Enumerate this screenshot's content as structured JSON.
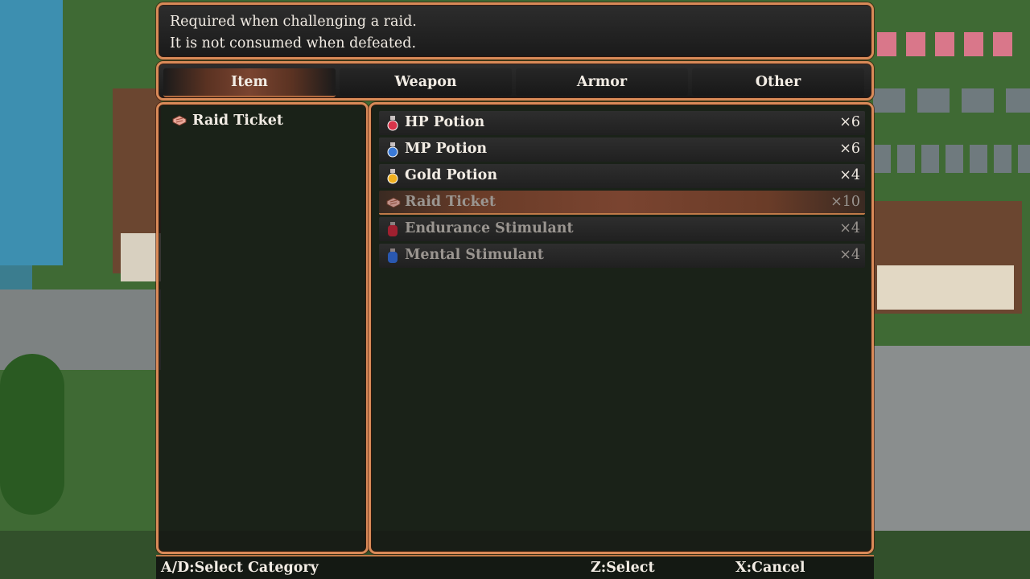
{
  "help": {
    "line1": "Required when challenging a raid.",
    "line2": "It is not consumed when defeated."
  },
  "categories": [
    {
      "label": "Item",
      "active": true
    },
    {
      "label": "Weapon",
      "active": false
    },
    {
      "label": "Armor",
      "active": false
    },
    {
      "label": "Other",
      "active": false
    }
  ],
  "detail": {
    "icon": "ticket-icon",
    "name": "Raid Ticket"
  },
  "items": [
    {
      "icon": "red-potion-icon",
      "name": "HP Potion",
      "qty": "×6",
      "state": "normal"
    },
    {
      "icon": "blue-potion-icon",
      "name": "MP Potion",
      "qty": "×6",
      "state": "normal"
    },
    {
      "icon": "gold-potion-icon",
      "name": "Gold Potion",
      "qty": "×4",
      "state": "normal"
    },
    {
      "icon": "ticket-icon",
      "name": "Raid Ticket",
      "qty": "×10",
      "state": "selected-disabled"
    },
    {
      "icon": "red-flask-icon",
      "name": "Endurance Stimulant",
      "qty": "×4",
      "state": "disabled"
    },
    {
      "icon": "blue-flask-icon",
      "name": "Mental Stimulant",
      "qty": "×4",
      "state": "disabled"
    }
  ],
  "footer": {
    "select_category": "A/D:Select Category",
    "select": "Z:Select",
    "cancel": "X:Cancel"
  },
  "colors": {
    "frame": "#d98a58",
    "highlight": "#7a4430",
    "text": "#f2ece4",
    "text_disabled": "#9a9590"
  }
}
